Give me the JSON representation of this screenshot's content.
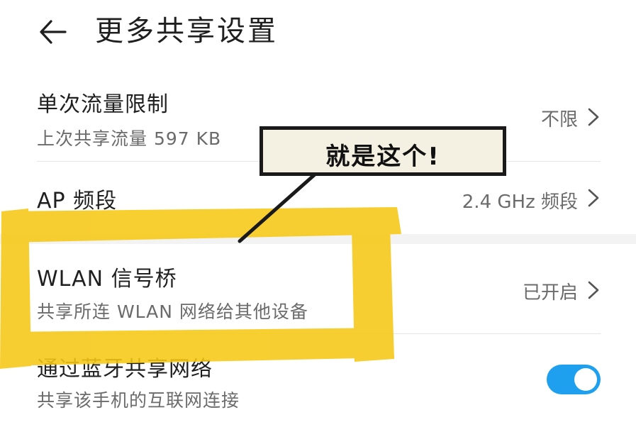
{
  "header": {
    "title": "更多共享设置",
    "back_icon": "back-arrow-icon"
  },
  "rows": [
    {
      "title": "单次流量限制",
      "subtitle": "上次共享流量 597 KB",
      "value": "不限"
    },
    {
      "title": "AP 频段",
      "value": "2.4 GHz 频段"
    },
    {
      "title": "WLAN 信号桥",
      "subtitle": "共享所连 WLAN 网络给其他设备",
      "value": "已开启"
    },
    {
      "title": "通过蓝牙共享网络",
      "subtitle": "共享该手机的互联网连接",
      "toggle_on": true
    }
  ],
  "annotation": {
    "text": "就是这个!",
    "highlight_color": "#f7c815"
  },
  "colors": {
    "accent": "#1ea0ef"
  }
}
